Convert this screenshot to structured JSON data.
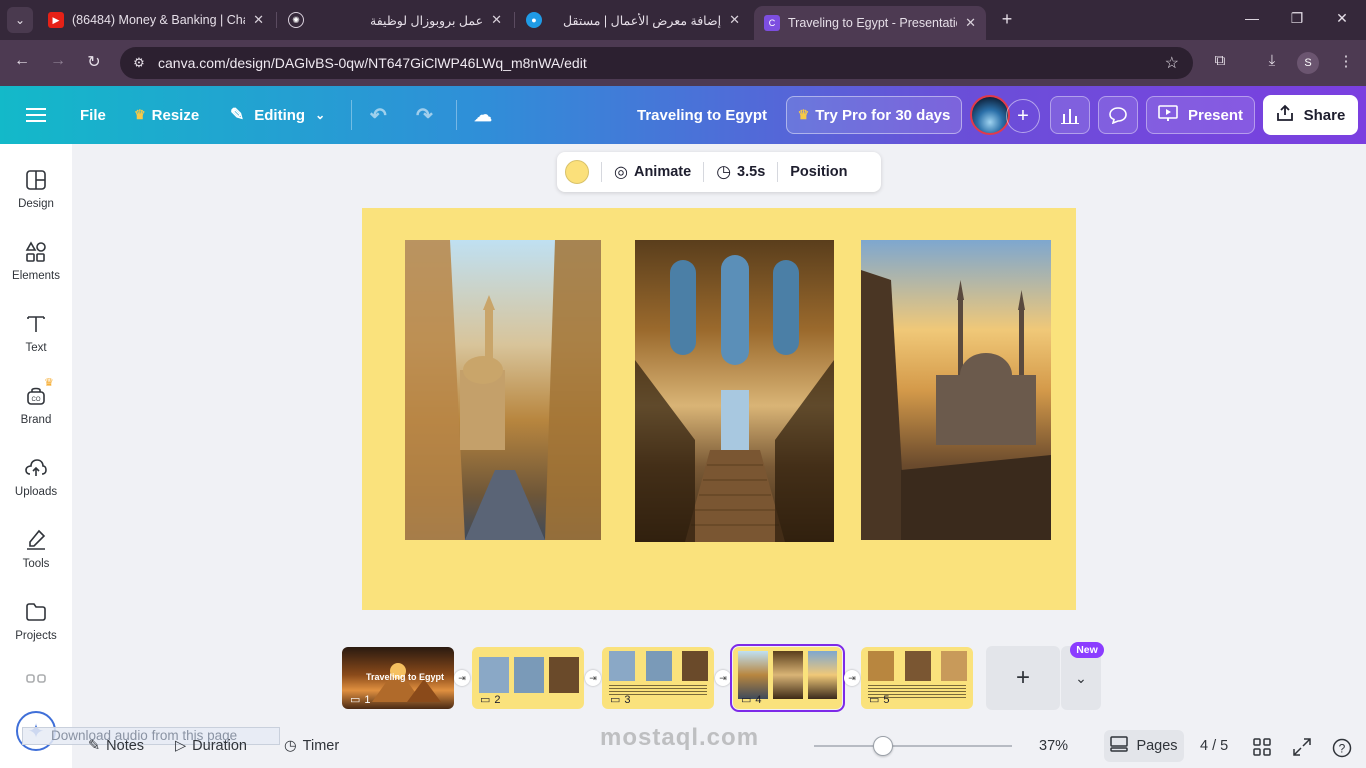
{
  "browser": {
    "tabs": [
      {
        "title": "(86484) Money & Banking | Cha",
        "icon": "youtube-icon"
      },
      {
        "title": "عمل بروبوزال لوظيفة",
        "icon": "chatgpt-icon"
      },
      {
        "title": "إضافة معرض الأعمال | مستقل",
        "icon": "mostaql-icon"
      },
      {
        "title": "Traveling to Egypt - Presentation",
        "icon": "canva-icon"
      }
    ],
    "url": "canva.com/design/DAGlvBS-0qw/NT647GiClWP46LWq_m8nWA/edit",
    "profile_initial": "S"
  },
  "header": {
    "file": "File",
    "resize": "Resize",
    "editing": "Editing",
    "doc_title": "Traveling to Egypt",
    "try_pro": "Try Pro for 30 days",
    "present": "Present",
    "share": "Share"
  },
  "sidebar": {
    "items": [
      {
        "label": "Design",
        "icon": "design-icon"
      },
      {
        "label": "Elements",
        "icon": "elements-icon"
      },
      {
        "label": "Text",
        "icon": "text-icon"
      },
      {
        "label": "Brand",
        "icon": "brand-icon"
      },
      {
        "label": "Uploads",
        "icon": "uploads-icon"
      },
      {
        "label": "Tools",
        "icon": "tools-icon"
      },
      {
        "label": "Projects",
        "icon": "projects-icon"
      }
    ]
  },
  "context_toolbar": {
    "color": "#fae27c",
    "animate": "Animate",
    "duration": "3.5s",
    "position": "Position"
  },
  "slide": {
    "background": "#fae27c",
    "images": [
      "cairo-street-photo",
      "palace-staircase-photo",
      "citadel-mosque-photo"
    ]
  },
  "pages": {
    "thumbnails": [
      {
        "num": "1",
        "title": "Traveling to Egypt"
      },
      {
        "num": "2"
      },
      {
        "num": "3"
      },
      {
        "num": "4",
        "selected": true
      },
      {
        "num": "5"
      }
    ],
    "new_badge": "New"
  },
  "bottom": {
    "download_audio": "Download audio from this page",
    "notes": "Notes",
    "duration": "Duration",
    "timer": "Timer",
    "zoom": "37%",
    "pages_label": "Pages",
    "page_count": "4 / 5",
    "watermark": "mostaql.com"
  }
}
